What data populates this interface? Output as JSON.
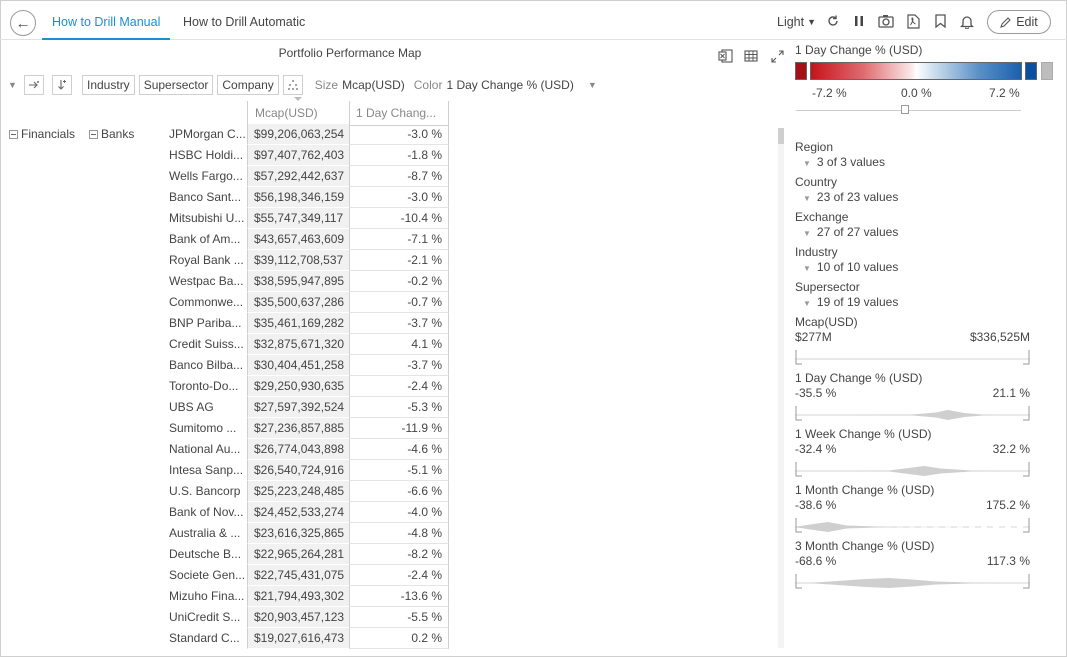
{
  "tabs": [
    {
      "label": "How to Drill Manual",
      "active": true
    },
    {
      "label": "How to Drill Automatic",
      "active": false
    }
  ],
  "header": {
    "theme_label": "Light",
    "edit_label": "Edit"
  },
  "icons": {
    "back": "arrow-left-icon",
    "refresh": "refresh-icon",
    "pause": "pause-icon",
    "snapshot": "camera-icon",
    "pdf": "pdf-icon",
    "bookmark": "bookmark-icon",
    "alert": "bell-icon",
    "edit": "pencil-icon"
  },
  "visual": {
    "title": "Portfolio Performance Map",
    "toolbar": {
      "hierarchy": [
        "Industry",
        "Supersector",
        "Company"
      ],
      "size_label": "Size",
      "size_value": "Mcap(USD)",
      "color_label": "Color",
      "color_value": "1 Day Change % (USD)"
    },
    "columns": [
      "Mcap(USD)",
      "1 Day Chang..."
    ],
    "group_industry": "Financials",
    "group_supersector": "Banks",
    "rows": [
      {
        "company": "JPMorgan C...",
        "mcap": "$99,206,063,254",
        "chg": "-3.0 %"
      },
      {
        "company": "HSBC Holdi...",
        "mcap": "$97,407,762,403",
        "chg": "-1.8 %"
      },
      {
        "company": "Wells Fargo...",
        "mcap": "$57,292,442,637",
        "chg": "-8.7 %"
      },
      {
        "company": "Banco Sant...",
        "mcap": "$56,198,346,159",
        "chg": "-3.0 %"
      },
      {
        "company": "Mitsubishi U...",
        "mcap": "$55,747,349,117",
        "chg": "-10.4 %"
      },
      {
        "company": "Bank of Am...",
        "mcap": "$43,657,463,609",
        "chg": "-7.1 %"
      },
      {
        "company": "Royal Bank ...",
        "mcap": "$39,112,708,537",
        "chg": "-2.1 %"
      },
      {
        "company": "Westpac Ba...",
        "mcap": "$38,595,947,895",
        "chg": "-0.2 %"
      },
      {
        "company": "Commonwe...",
        "mcap": "$35,500,637,286",
        "chg": "-0.7 %"
      },
      {
        "company": "BNP Pariba...",
        "mcap": "$35,461,169,282",
        "chg": "-3.7 %"
      },
      {
        "company": "Credit Suiss...",
        "mcap": "$32,875,671,320",
        "chg": "4.1 %"
      },
      {
        "company": "Banco Bilba...",
        "mcap": "$30,404,451,258",
        "chg": "-3.7 %"
      },
      {
        "company": "Toronto-Do...",
        "mcap": "$29,250,930,635",
        "chg": "-2.4 %"
      },
      {
        "company": "UBS AG",
        "mcap": "$27,597,392,524",
        "chg": "-5.3 %"
      },
      {
        "company": "Sumitomo ...",
        "mcap": "$27,236,857,885",
        "chg": "-11.9 %"
      },
      {
        "company": "National Au...",
        "mcap": "$26,774,043,898",
        "chg": "-4.6 %"
      },
      {
        "company": "Intesa Sanp...",
        "mcap": "$26,540,724,916",
        "chg": "-5.1 %"
      },
      {
        "company": "U.S. Bancorp",
        "mcap": "$25,223,248,485",
        "chg": "-6.6 %"
      },
      {
        "company": "Bank of Nov...",
        "mcap": "$24,452,533,274",
        "chg": "-4.0 %"
      },
      {
        "company": "Australia & ...",
        "mcap": "$23,616,325,865",
        "chg": "-4.8 %"
      },
      {
        "company": "Deutsche B...",
        "mcap": "$22,965,264,281",
        "chg": "-8.2 %"
      },
      {
        "company": "Societe Gen...",
        "mcap": "$22,745,431,075",
        "chg": "-2.4 %"
      },
      {
        "company": "Mizuho Fina...",
        "mcap": "$21,794,493,302",
        "chg": "-13.6 %"
      },
      {
        "company": "UniCredit S...",
        "mcap": "$20,903,457,123",
        "chg": "-5.5 %"
      },
      {
        "company": "Standard C...",
        "mcap": "$19,027,616,473",
        "chg": "0.2 %"
      }
    ]
  },
  "color_legend": {
    "title": "1 Day Change % (USD)",
    "min": "-7.2 %",
    "mid": "0.0 %",
    "max": "7.2 %",
    "colors": {
      "below": "#a50f15",
      "above": "#0b4fa0",
      "null": "#bdbdbd"
    }
  },
  "filters": [
    {
      "name": "Region",
      "value": "3 of 3 values"
    },
    {
      "name": "Country",
      "value": "23 of 23 values"
    },
    {
      "name": "Exchange",
      "value": "27 of 27 values"
    },
    {
      "name": "Industry",
      "value": "10 of 10 values"
    },
    {
      "name": "Supersector",
      "value": "19 of 19 values"
    }
  ],
  "ranges": [
    {
      "name": "Mcap(USD)",
      "min": "$277M",
      "max": "$336,525M"
    },
    {
      "name": "1 Day Change % (USD)",
      "min": "-35.5 %",
      "max": "21.1 %"
    },
    {
      "name": "1 Week Change % (USD)",
      "min": "-32.4 %",
      "max": "32.2 %"
    },
    {
      "name": "1 Month Change % (USD)",
      "min": "-38.6 %",
      "max": "175.2 %"
    },
    {
      "name": "3 Month Change % (USD)",
      "min": "-68.6 %",
      "max": "117.3 %"
    }
  ]
}
